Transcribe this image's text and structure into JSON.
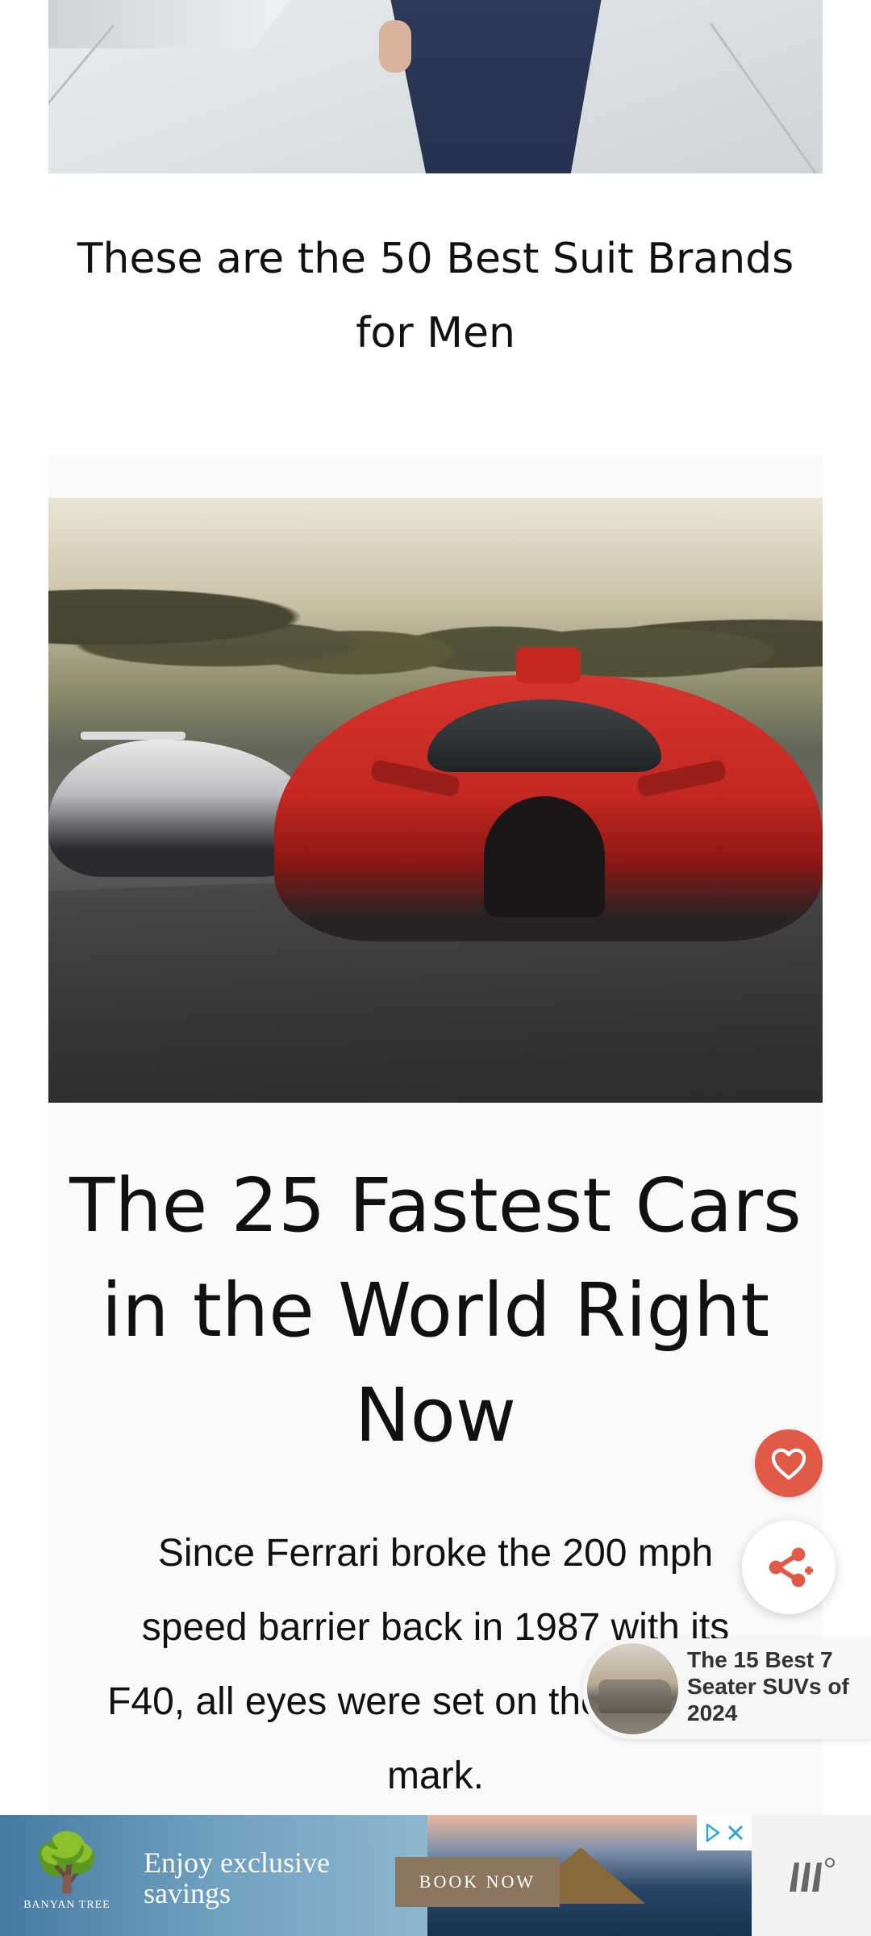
{
  "articles": [
    {
      "title": "These are the 50 Best Suit Brands for Men",
      "image_alt": "suit-photo"
    },
    {
      "title": "The 25 Fastest Cars in the World Right Now",
      "excerpt": "Since Ferrari broke the 200 mph speed barrier back in 1987 with its F40, all eyes were set on the 300 mph mark.",
      "image_alt": "hypercar-photo"
    }
  ],
  "floating_actions": {
    "heart_icon": "heart-icon",
    "share_icon": "share-icon",
    "heart_color": "#e05a47",
    "share_color": "#e05a47"
  },
  "recommended": {
    "title": "The 15 Best 7 Seater SUVs of 2024"
  },
  "ad": {
    "brand": "BANYAN TREE",
    "tagline": "Enjoy exclusive savings",
    "cta": "BOOK NOW",
    "side_logo": "Ш⁰"
  }
}
